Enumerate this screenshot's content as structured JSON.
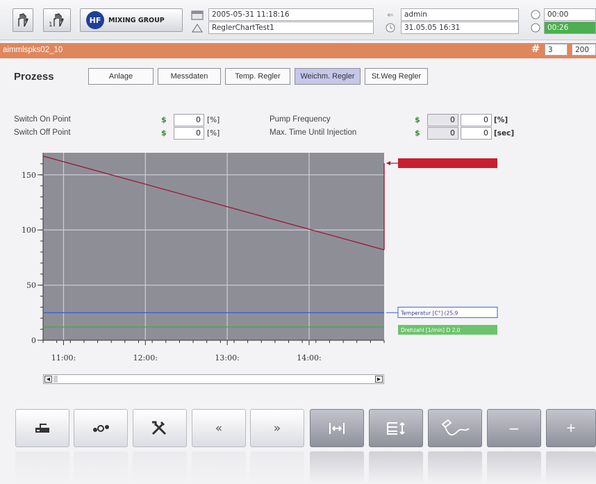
{
  "header": {
    "company": "MIXING GROUP",
    "logo_text": "HF",
    "date_time": "2005-05-31 11:18:16",
    "chart_name": "ReglerChartTest1",
    "user": "admin",
    "user_date": "31.05.05 16:31",
    "timer1": "00:00",
    "timer2": "00:26",
    "page_index": "3",
    "page_value": "200"
  },
  "title_bar": {
    "text": "aimmlspks02_10"
  },
  "section_title": "Prozess",
  "tabs": [
    {
      "label": "Anlage"
    },
    {
      "label": "Messdaten"
    },
    {
      "label": "Temp. Regler"
    },
    {
      "label": "Weichm. Regler"
    },
    {
      "label": "St.Weg Regler"
    }
  ],
  "params": {
    "switch_on": {
      "label": "Switch On Point",
      "value": "0",
      "unit": "[%]"
    },
    "switch_off": {
      "label": "Switch Off Point",
      "value": "0",
      "unit": "[%]"
    },
    "pump_freq": {
      "label": "Pump Frequency",
      "value1": "0",
      "value2": "0",
      "unit": "[%]"
    },
    "max_time": {
      "label": "Max. Time Until Injection",
      "value1": "0",
      "value2": "0",
      "unit": "[sec]"
    }
  },
  "chart_data": {
    "type": "line",
    "yticks": [
      "0",
      "50",
      "100",
      "150"
    ],
    "xticks": [
      "11:00:",
      "12:00:",
      "13:00:",
      "14:00:"
    ],
    "ylim": [
      0,
      170
    ],
    "grid": true,
    "series": [
      {
        "color": "#9b1d3a",
        "x": [
          "10:45",
          "14:55"
        ],
        "y": [
          167,
          82
        ]
      },
      {
        "color": "#3b5fd6",
        "x": [
          "10:45",
          "14:55"
        ],
        "y": [
          25,
          25
        ]
      },
      {
        "color": "#3cb043",
        "x": [
          "10:45",
          "14:55"
        ],
        "y": [
          12,
          12
        ]
      }
    ],
    "legend": {
      "red_label": "",
      "blue_label": "Temperatur [C°] (25,9",
      "green_label": "Drehzahl [1/min] D 2,0"
    },
    "legend_placement": "right"
  },
  "colors": {
    "accent": "#e0865c",
    "active_tab": "#c5c6ea",
    "plot_bg": "#8e8f96"
  },
  "bottom_buttons": [
    {
      "icon": "machine-icon"
    },
    {
      "icon": "molecule-icon"
    },
    {
      "icon": "tools-icon"
    },
    {
      "icon": "back-icon"
    },
    {
      "icon": "forward-icon"
    },
    {
      "icon": "fit-width-icon"
    },
    {
      "icon": "fit-height-icon"
    },
    {
      "icon": "draw-curve-icon"
    },
    {
      "icon": "minus-icon",
      "label": "−"
    },
    {
      "icon": "plus-icon",
      "label": "+"
    }
  ]
}
